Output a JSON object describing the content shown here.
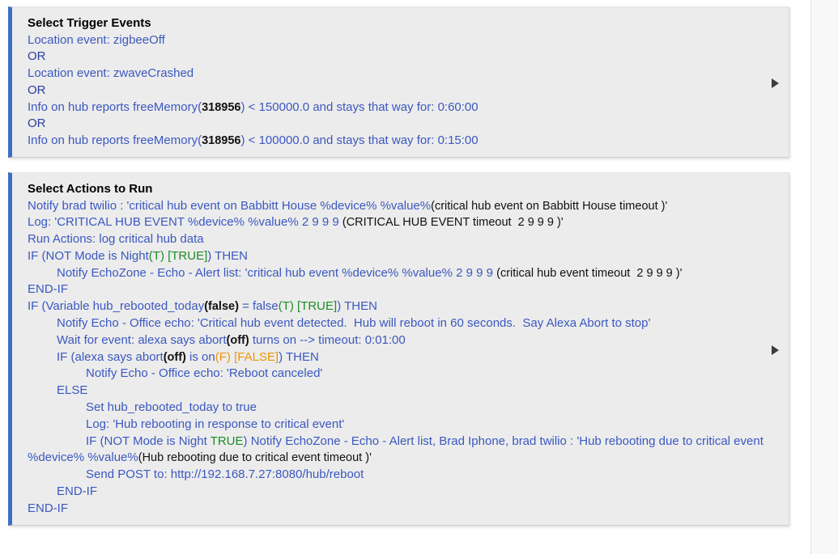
{
  "colors": {
    "panel_bg": "#ececec",
    "accent_bar": "#3d6ec4",
    "rule_text": "#3b58c0",
    "true_value": "#1d8c27",
    "false_value": "#eb9608",
    "literal_value": "#111111"
  },
  "triggers_panel": {
    "title": "Select Trigger Events",
    "expander_icon": "play-triangle-right-icon",
    "lines": [
      {
        "id": "trigger-location-zigbee",
        "segments": [
          {
            "text": "Location event: zigbeeOff",
            "style": "rule"
          }
        ]
      },
      {
        "id": "trigger-or-1",
        "segments": [
          {
            "text": "OR",
            "style": "op"
          }
        ]
      },
      {
        "id": "trigger-location-zwave",
        "segments": [
          {
            "text": "Location event: zwaveCrashed",
            "style": "rule"
          }
        ]
      },
      {
        "id": "trigger-or-2",
        "segments": [
          {
            "text": "OR",
            "style": "op"
          }
        ]
      },
      {
        "id": "trigger-freememory-150000",
        "segments": [
          {
            "text": "Info on hub reports freeMemory(",
            "style": "rule"
          },
          {
            "text": "318956",
            "style": "literal"
          },
          {
            "text": ") < 150000.0 and ",
            "style": "rule"
          },
          {
            "text": "stays",
            "style": "keyword"
          },
          {
            "text": " that way for: 0:60:00",
            "style": "rule"
          }
        ]
      },
      {
        "id": "trigger-or-3",
        "segments": [
          {
            "text": "OR",
            "style": "op"
          }
        ]
      },
      {
        "id": "trigger-freememory-100000",
        "segments": [
          {
            "text": "Info on hub reports freeMemory(",
            "style": "rule"
          },
          {
            "text": "318956",
            "style": "literal"
          },
          {
            "text": ") < 100000.0 and ",
            "style": "rule"
          },
          {
            "text": "stays",
            "style": "keyword"
          },
          {
            "text": " that way for: 0:15:00",
            "style": "rule"
          }
        ]
      }
    ]
  },
  "actions_panel": {
    "title": "Select Actions to Run",
    "expander_icon": "play-triangle-right-icon",
    "lines": [
      {
        "id": "action-notify-brad-twilio",
        "indent": 0,
        "segments": [
          {
            "text": "Notify brad twilio : 'critical hub event on Babbitt House %device% %value%",
            "style": "rule"
          },
          {
            "text": "(critical hub event on Babbitt House timeout )'",
            "style": "literal-normal"
          }
        ]
      },
      {
        "id": "action-log-critical",
        "indent": 0,
        "segments": [
          {
            "text": "Log: 'CRITICAL HUB EVENT %device% %value% 2 9 9 9 ",
            "style": "rule"
          },
          {
            "text": "(CRITICAL HUB EVENT timeout  2 9 9 9 )'",
            "style": "literal-normal"
          }
        ]
      },
      {
        "id": "action-run-actions",
        "indent": 0,
        "segments": [
          {
            "text": "Run Actions: log critical hub data",
            "style": "rule"
          }
        ]
      },
      {
        "id": "action-if-not-night",
        "indent": 0,
        "segments": [
          {
            "text": "IF (",
            "style": "rule"
          },
          {
            "text": "NOT",
            "style": "keyword"
          },
          {
            "text": " Mode is Night",
            "style": "rule"
          },
          {
            "text": "(T) [TRUE]",
            "style": "true"
          },
          {
            "text": ") THEN",
            "style": "rule"
          }
        ]
      },
      {
        "id": "action-notify-echozone",
        "indent": 1,
        "segments": [
          {
            "text": "Notify EchoZone - Echo - Alert list: 'critical hub event %device% %value% 2 9 9 9 ",
            "style": "rule"
          },
          {
            "text": "(critical hub event timeout  2 9 9 9 )'",
            "style": "literal-normal"
          }
        ]
      },
      {
        "id": "action-end-if-1",
        "indent": 0,
        "segments": [
          {
            "text": "END-IF",
            "style": "rule"
          }
        ]
      },
      {
        "id": "action-if-variable-rebooted",
        "indent": 0,
        "segments": [
          {
            "text": "IF (Variable hub_rebooted_today",
            "style": "rule"
          },
          {
            "text": "(false)",
            "style": "literal"
          },
          {
            "text": " = false",
            "style": "rule"
          },
          {
            "text": "(T) [TRUE]",
            "style": "true"
          },
          {
            "text": ") THEN",
            "style": "rule"
          }
        ]
      },
      {
        "id": "action-notify-office-echo",
        "indent": 1,
        "segments": [
          {
            "text": "Notify Echo - Office echo: 'Critical hub event detected.  Hub will reboot in 60 seconds.  Say Alexa Abort to stop'",
            "style": "rule"
          }
        ]
      },
      {
        "id": "action-wait-for-event",
        "indent": 1,
        "segments": [
          {
            "text": "Wait for event: alexa says abort",
            "style": "rule"
          },
          {
            "text": "(off)",
            "style": "literal"
          },
          {
            "text": " turns on --> timeout: 0:01:00",
            "style": "rule"
          }
        ]
      },
      {
        "id": "action-if-alexa-abort",
        "indent": 1,
        "segments": [
          {
            "text": "IF (alexa says abort",
            "style": "rule"
          },
          {
            "text": "(off)",
            "style": "literal"
          },
          {
            "text": " is on",
            "style": "rule"
          },
          {
            "text": "(F) [FALSE]",
            "style": "false"
          },
          {
            "text": ") THEN",
            "style": "rule"
          }
        ]
      },
      {
        "id": "action-notify-reboot-canceled",
        "indent": 2,
        "segments": [
          {
            "text": "Notify Echo - Office echo: 'Reboot canceled'",
            "style": "rule"
          }
        ]
      },
      {
        "id": "action-else",
        "indent": 1,
        "segments": [
          {
            "text": "ELSE",
            "style": "rule"
          }
        ]
      },
      {
        "id": "action-set-variable-true",
        "indent": 2,
        "segments": [
          {
            "text": "Set hub_rebooted_today to true",
            "style": "rule"
          }
        ]
      },
      {
        "id": "action-log-rebooting",
        "indent": 2,
        "segments": [
          {
            "text": "Log: 'Hub rebooting in response to critical event'",
            "style": "rule"
          }
        ]
      },
      {
        "id": "action-if-not-night-2",
        "indent": 2,
        "wrap": true,
        "segments": [
          {
            "text": "IF (",
            "style": "rule"
          },
          {
            "text": "NOT",
            "style": "keyword"
          },
          {
            "text": " Mode is Night ",
            "style": "rule"
          },
          {
            "text": "TRUE",
            "style": "true"
          },
          {
            "text": ") Notify EchoZone - Echo - Alert list, Brad Iphone, brad twilio : 'Hub rebooting due to critical event %device% %value%",
            "style": "rule"
          },
          {
            "text": "(Hub rebooting due to critical event timeout )'",
            "style": "literal-normal"
          }
        ]
      },
      {
        "id": "action-send-post",
        "indent": 2,
        "segments": [
          {
            "text": "Send POST to: http://192.168.7.27:8080/hub/reboot",
            "style": "rule"
          }
        ]
      },
      {
        "id": "action-end-if-2",
        "indent": 1,
        "segments": [
          {
            "text": "END-IF",
            "style": "rule"
          }
        ]
      },
      {
        "id": "action-end-if-3",
        "indent": 0,
        "segments": [
          {
            "text": "END-IF",
            "style": "rule"
          }
        ]
      }
    ]
  }
}
